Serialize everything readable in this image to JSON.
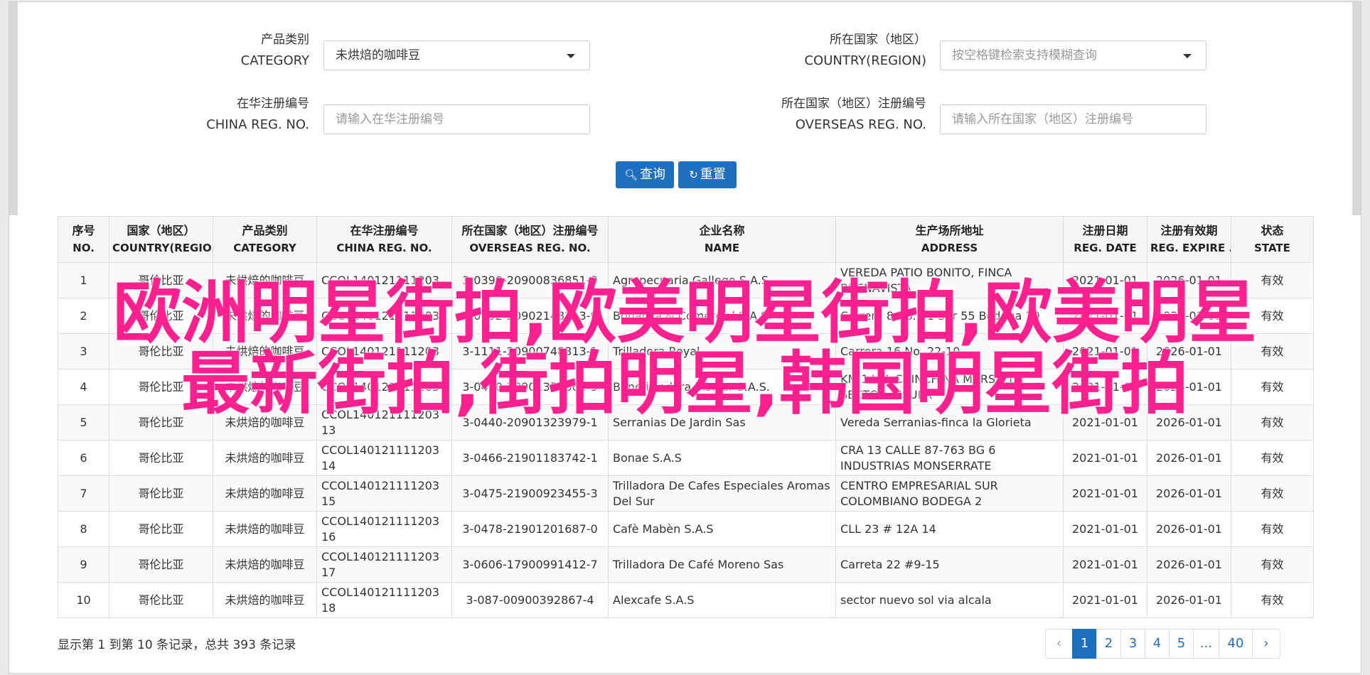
{
  "form": {
    "category_label_cn": "产品类别",
    "category_label_en": "CATEGORY",
    "category_value": "未烘焙的咖啡豆",
    "country_label_cn": "所在国家（地区）",
    "country_label_en": "COUNTRY(REGION)",
    "country_placeholder": "按空格键检索支持模糊查询",
    "china_reg_label_cn": "在华注册编号",
    "china_reg_label_en": "CHINA REG. NO.",
    "china_reg_placeholder": "请输入在华注册编号",
    "overseas_reg_label_cn": "所在国家（地区）注册编号",
    "overseas_reg_label_en": "OVERSEAS REG. NO.",
    "overseas_reg_placeholder": "请输入所在国家（地区）注册编号",
    "search_label": "查询",
    "reset_label": "重置"
  },
  "table": {
    "headers": [
      {
        "cn": "序号",
        "en": "NO."
      },
      {
        "cn": "国家（地区）",
        "en": "COUNTRY(REGIO..."
      },
      {
        "cn": "产品类别",
        "en": "CATEGORY"
      },
      {
        "cn": "在华注册编号",
        "en": "CHINA REG. NO."
      },
      {
        "cn": "所在国家（地区）注册编号",
        "en": "OVERSEAS REG. NO."
      },
      {
        "cn": "企业名称",
        "en": "NAME"
      },
      {
        "cn": "生产场所地址",
        "en": "ADDRESS"
      },
      {
        "cn": "注册日期",
        "en": "REG. DATE"
      },
      {
        "cn": "注册有效期",
        "en": "REG. EXPIRE ..."
      },
      {
        "cn": "状态",
        "en": "STATE"
      }
    ],
    "rows": [
      {
        "no": "1",
        "country": "哥伦比亚",
        "category": "未烘焙的咖啡豆",
        "china_reg": "CCOL140121111203",
        "overseas_reg": "3-0390-20900836851-0",
        "name": "Agropecuaria Gallego S.A.S.",
        "address": "VEREDA PATIO BONITO, FINCA BUENAVISTA",
        "reg_date": "2021-01-01",
        "expire": "2026-01-01",
        "state": "有效"
      },
      {
        "no": "2",
        "country": "哥伦比亚",
        "category": "未烘焙的咖啡豆",
        "china_reg": "CCOL140121111203",
        "overseas_reg": "3-0392-20902148213-9",
        "name": "Bonanza & Comercial S.A.S.",
        "address": "Carrera 8 No. 51 Sur 55 Bodega 10",
        "reg_date": "2021-01-01",
        "expire": "2026-01-01",
        "state": "有效"
      },
      {
        "no": "3",
        "country": "哥伦比亚",
        "category": "未烘焙的咖啡豆",
        "china_reg": "CCOL140121111203",
        "overseas_reg": "3-1111-20900748313-1",
        "name": "Trilladora Royal",
        "address": "Carrera 16 No. 22-10",
        "reg_date": "2021-01-01",
        "expire": "2026-01-01",
        "state": "有效"
      },
      {
        "no": "4",
        "country": "哥伦比亚",
        "category": "未烘焙的咖啡豆",
        "china_reg": "CCOL140121111203",
        "overseas_reg": "3-0420-20901358661-9",
        "name": "Beneficiadora Insular S.A.S.",
        "address": "KM 1 VIA CHINCHINA MARSELLA SECTOR INSULA",
        "reg_date": "2021-01-01",
        "expire": "2026-01-01",
        "state": "有效"
      },
      {
        "no": "5",
        "country": "哥伦比亚",
        "category": "未烘焙的咖啡豆",
        "china_reg": "CCOL140121111203 13",
        "overseas_reg": "3-0440-20901323979-1",
        "name": "Serranias De Jardin Sas",
        "address": "Vereda Serranias-finca la Glorieta",
        "reg_date": "2021-01-01",
        "expire": "2026-01-01",
        "state": "有效"
      },
      {
        "no": "6",
        "country": "哥伦比亚",
        "category": "未烘焙的咖啡豆",
        "china_reg": "CCOL140121111203 14",
        "overseas_reg": "3-0466-21901183742-1",
        "name": "Bonae S.A.S",
        "address": "CRA 13 CALLE 87-763 BG 6 INDUSTRIAS MONSERRATE",
        "reg_date": "2021-01-01",
        "expire": "2026-01-01",
        "state": "有效"
      },
      {
        "no": "7",
        "country": "哥伦比亚",
        "category": "未烘焙的咖啡豆",
        "china_reg": "CCOL140121111203 15",
        "overseas_reg": "3-0475-21900923455-3",
        "name": "Trilladora De Cafes Especiales Aromas Del Sur",
        "address": "CENTRO EMPRESARIAL SUR COLOMBIANO BODEGA 2",
        "reg_date": "2021-01-01",
        "expire": "2026-01-01",
        "state": "有效"
      },
      {
        "no": "8",
        "country": "哥伦比亚",
        "category": "未烘焙的咖啡豆",
        "china_reg": "CCOL140121111203 16",
        "overseas_reg": "3-0478-21901201687-0",
        "name": "Cafè Mabèn S.A.S",
        "address": "CLL 23 # 12A 14",
        "reg_date": "2021-01-01",
        "expire": "2026-01-01",
        "state": "有效"
      },
      {
        "no": "9",
        "country": "哥伦比亚",
        "category": "未烘焙的咖啡豆",
        "china_reg": "CCOL140121111203 17",
        "overseas_reg": "3-0606-17900991412-7",
        "name": "Trilladora De Café Moreno Sas",
        "address": "Carreta 22 #9-15",
        "reg_date": "2021-01-01",
        "expire": "2026-01-01",
        "state": "有效"
      },
      {
        "no": "10",
        "country": "哥伦比亚",
        "category": "未烘焙的咖啡豆",
        "china_reg": "CCOL140121111203 18",
        "overseas_reg": "3-087-00900392867-4",
        "name": "Alexcafe S.A.S",
        "address": "sector nuevo sol via alcala",
        "reg_date": "2021-01-01",
        "expire": "2026-01-01",
        "state": "有效"
      }
    ]
  },
  "summary": "显示第 1 到第 10 条记录，总共 393 条记录",
  "pagination": {
    "prev": "‹",
    "pages": [
      "1",
      "2",
      "3",
      "4",
      "5",
      "...",
      "40"
    ],
    "next": "›",
    "active": "1"
  },
  "overlay": {
    "line1": "欧洲明星街拍,欧美明星街拍,欧美明星",
    "line2": "最新街拍,街拍明星,韩国明星街拍"
  },
  "colors": {
    "primary": "#1f6fbf",
    "overlay": "#ff1f8e"
  }
}
